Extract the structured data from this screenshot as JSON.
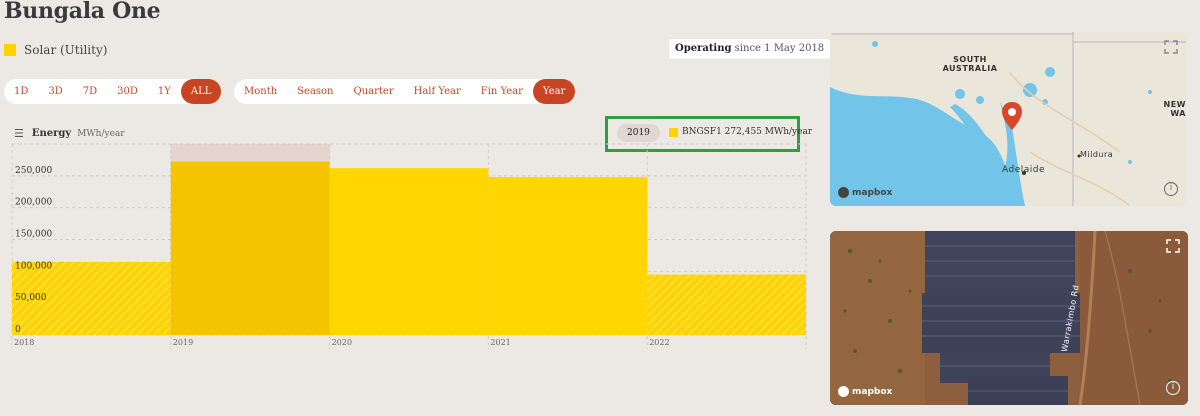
{
  "facility": {
    "title": "Bungala One",
    "fuel_label": "Solar (Utility)",
    "fuel_color": "#ffd200",
    "status_bold": "Operating",
    "status_rest": " since 1 May 2018"
  },
  "ranges": {
    "items": [
      "1D",
      "3D",
      "7D",
      "30D",
      "1Y",
      "ALL"
    ],
    "active": "ALL"
  },
  "intervals": {
    "items": [
      "Month",
      "Season",
      "Quarter",
      "Half Year",
      "Fin Year",
      "Year"
    ],
    "active": "Year"
  },
  "energy": {
    "menu_icon": "hamburger-icon",
    "label": "Energy",
    "unit": "MWh/year"
  },
  "legend": {
    "year": "2019",
    "series_label": "BNGSF1 272,455 MWh/year"
  },
  "accent_color": "#c74523",
  "highlight_color": "#2ea043",
  "chart_data": {
    "type": "bar",
    "categories": [
      "2018",
      "2019",
      "2020",
      "2021",
      "2022"
    ],
    "series": [
      {
        "name": "BNGSF1",
        "values": [
          115000,
          272455,
          262000,
          248000,
          95000
        ]
      }
    ],
    "highlighted_category": "2019",
    "ylim": [
      0,
      300000
    ],
    "yticks": [
      "0",
      "50,000",
      "100,000",
      "150,000",
      "200,000",
      "250,000"
    ],
    "ytick_values": [
      0,
      50000,
      100000,
      150000,
      200000,
      250000
    ],
    "partial_periods": [
      "2018",
      "2022"
    ],
    "grid": true
  },
  "map": {
    "labels": [
      "SOUTH AUSTRALIA",
      "Adelaide",
      "Mildura",
      "NEW WA"
    ],
    "attribution": "mapbox",
    "marker_icon": "map-pin-icon"
  },
  "satellite": {
    "road_label": "Warrakimbo Rd",
    "attribution": "mapbox"
  }
}
